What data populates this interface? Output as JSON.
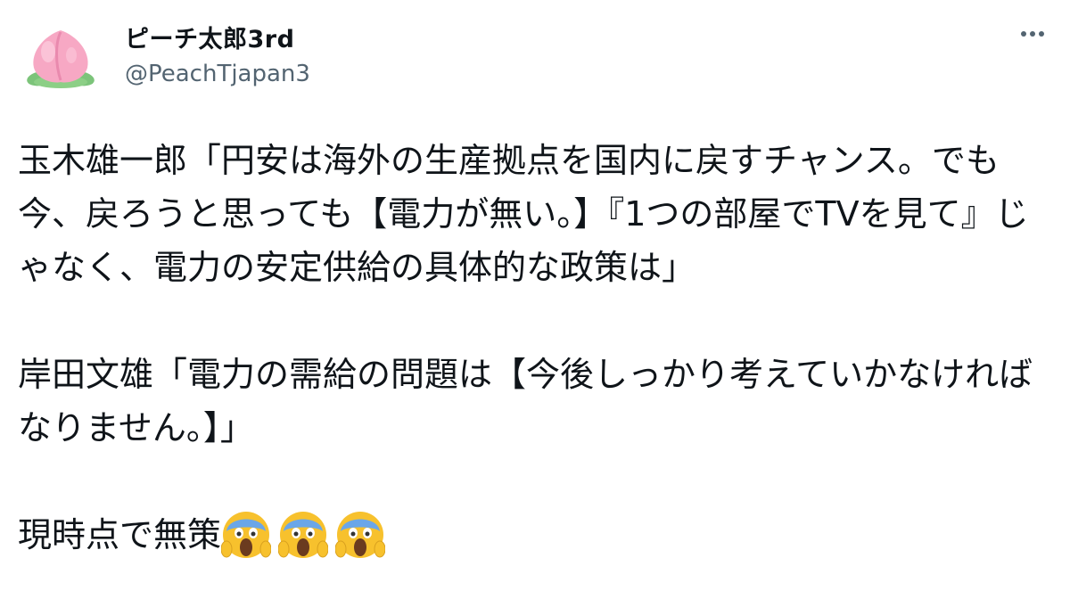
{
  "author": {
    "name": "ピーチ太郎3rd",
    "handle": "@PeachTjapan3",
    "avatar_icon": "peach-icon"
  },
  "tweet": {
    "paragraph_1": "玉木雄一郎「円安は海外の生産拠点を国内に戻すチャンス。でも今、戻ろうと思っても【電力が無い。】『1つの部屋でTVを見て』じゃなく、電力の安定供給の具体的な政策は」",
    "paragraph_2": "岸田文雄「電力の需給の問題は【今後しっかり考えていかなければなりません。】」",
    "paragraph_3": "現時点で無策",
    "emojis": [
      "face-screaming-in-fear-emoji",
      "face-screaming-in-fear-emoji",
      "face-screaming-in-fear-emoji"
    ]
  },
  "menu": {
    "icon": "more-horizontal-icon"
  },
  "colors": {
    "text": "#0f1419",
    "secondary": "#536471",
    "peach_pink": "#f7a8c4",
    "leaf_green": "#7cc47a",
    "emoji_yellow": "#f7c12d",
    "emoji_blue": "#6aa6e8"
  }
}
